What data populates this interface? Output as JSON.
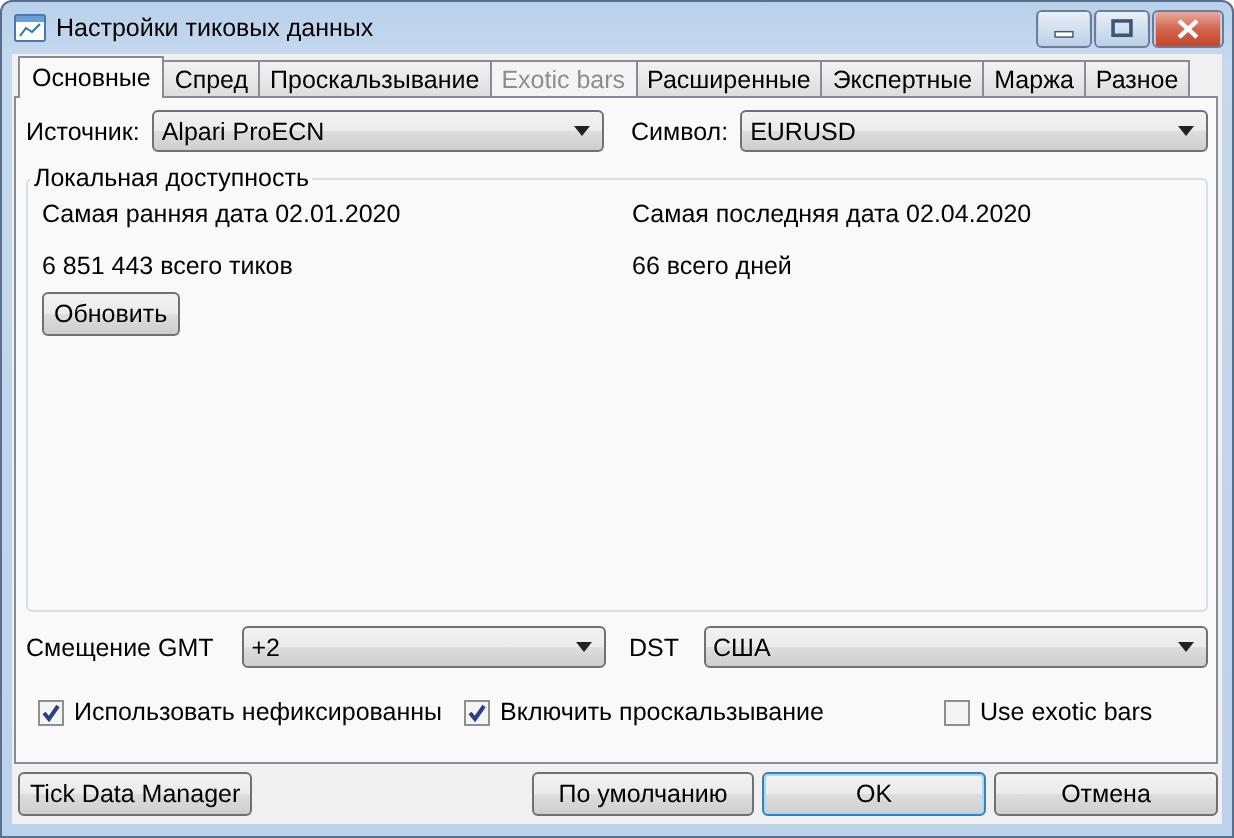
{
  "window": {
    "title": "Настройки тиковых данных"
  },
  "tabs": [
    {
      "label": "Основные",
      "selected": true,
      "disabled": false
    },
    {
      "label": "Спред",
      "selected": false,
      "disabled": false
    },
    {
      "label": "Проскальзывание",
      "selected": false,
      "disabled": false
    },
    {
      "label": "Exotic bars",
      "selected": false,
      "disabled": true
    },
    {
      "label": "Расширенные",
      "selected": false,
      "disabled": false
    },
    {
      "label": "Экспертные",
      "selected": false,
      "disabled": false
    },
    {
      "label": "Маржа",
      "selected": false,
      "disabled": false
    },
    {
      "label": "Разное",
      "selected": false,
      "disabled": false
    }
  ],
  "source": {
    "label": "Источник:",
    "value": "Alpari ProECN"
  },
  "symbol": {
    "label": "Символ:",
    "value": "EURUSD"
  },
  "local_availability": {
    "title": "Локальная доступность",
    "earliest": "Самая ранняя дата 02.01.2020",
    "latest": "Самая последняя дата 02.04.2020",
    "total_ticks": "6 851 443 всего тиков",
    "total_days": "66 всего дней",
    "refresh_button": "Обновить"
  },
  "gmt_offset": {
    "label": "Смещение GMT",
    "value": "+2"
  },
  "dst": {
    "label": "DST",
    "value": "США"
  },
  "options": [
    {
      "label": "Использовать нефиксированны",
      "checked": true
    },
    {
      "label": "Включить проскальзывание",
      "checked": true
    },
    {
      "label": "Use exotic bars",
      "checked": false
    }
  ],
  "buttons": [
    {
      "label": "Tick Data Manager",
      "default": false
    },
    {
      "label": "По умолчанию",
      "default": false
    },
    {
      "label": "OK",
      "default": true
    },
    {
      "label": "Отмена",
      "default": false
    }
  ]
}
